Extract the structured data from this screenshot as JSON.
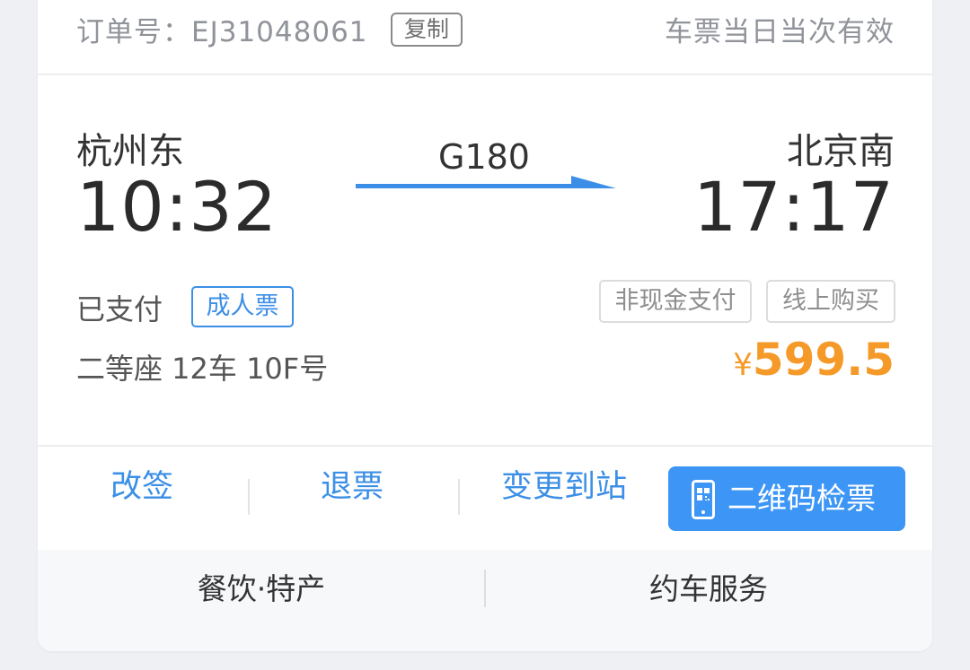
{
  "order": {
    "label": "订单号：EJ31048061",
    "copy_label": "复制",
    "validity": "车票当日当次有效"
  },
  "trip": {
    "from_station": "杭州东",
    "to_station": "北京南",
    "departure_time": "10:32",
    "arrival_time": "17:17",
    "train_no": "G180"
  },
  "ticket": {
    "pay_status": "已支付",
    "ticket_type": "成人票",
    "tags": [
      "非现金支付",
      "线上购买"
    ],
    "seat": "二等座 12车 10F号",
    "currency": "¥",
    "price": "599.5"
  },
  "actions": {
    "change": "改签",
    "refund": "退票",
    "change_destination": "变更到站",
    "qr_check": "二维码检票",
    "qr_icon": "phone-qr-icon"
  },
  "services": {
    "food": "餐饮·特产",
    "car": "约车服务"
  },
  "colors": {
    "accent": "#3c8fe6",
    "button_bg": "#3d96f5",
    "price": "#f59a28",
    "muted_text": "#909399"
  }
}
